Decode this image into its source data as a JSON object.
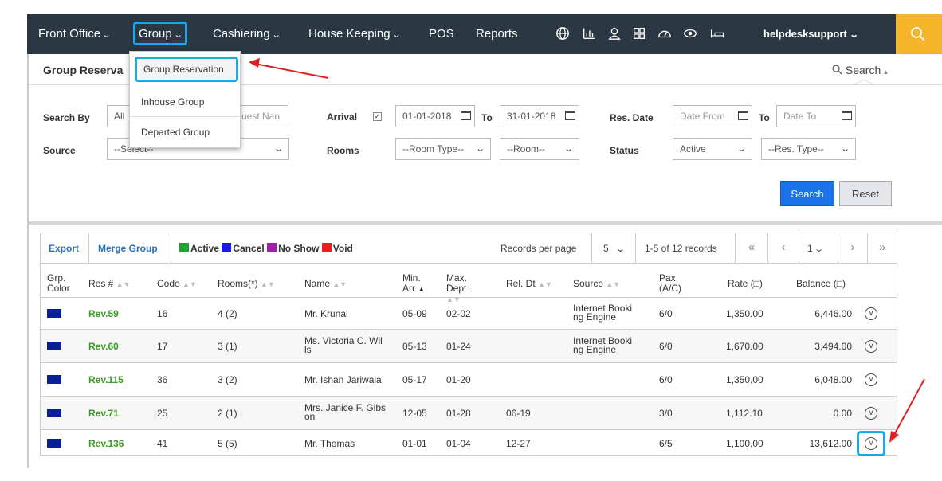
{
  "nav": {
    "front_office": "Front Office",
    "group": "Group",
    "cashiering": "Cashiering",
    "house_keeping": "House Keeping",
    "pos": "POS",
    "reports": "Reports",
    "user": "helpdesksupport",
    "icons": [
      "globe-icon",
      "chart-icon",
      "user-icon",
      "grid-icon",
      "dashboard-icon",
      "eye-icon",
      "bed-icon"
    ],
    "search_icon": "search-icon",
    "accent": "#1ea7e6",
    "search_bg": "#f5b52a"
  },
  "panel": {
    "title": "Group Reserva",
    "search_toggle": "Search"
  },
  "dropdown": {
    "items": [
      "Group Reservation",
      "Inhouse Group",
      "Departed Group"
    ]
  },
  "form": {
    "search_by_label": "Search By",
    "search_by_value": "All",
    "guest_name_placeholder": "uest Nan",
    "arrival_label": "Arrival",
    "arrival_from": "01-01-2018",
    "to_label": "To",
    "arrival_to": "31-01-2018",
    "res_date_label": "Res. Date",
    "date_from_placeholder": "Date From",
    "date_to_placeholder": "Date To",
    "source_label": "Source",
    "source_value": "--Select--",
    "rooms_label": "Rooms",
    "room_type_value": "--Room Type--",
    "room_value": "--Room--",
    "status_label": "Status",
    "status_value": "Active",
    "res_type_value": "--Res. Type--",
    "search_button": "Search",
    "reset_button": "Reset"
  },
  "toolbar": {
    "export": "Export",
    "merge_group": "Merge Group",
    "legend": [
      {
        "label": "Active",
        "color": "#1fa533"
      },
      {
        "label": "Cancel",
        "color": "#1a1ae6"
      },
      {
        "label": "No Show",
        "color": "#a020a8"
      },
      {
        "label": "Void",
        "color": "#e62020"
      }
    ],
    "records_per_page_label": "Records per page",
    "records_per_page": "5",
    "records_info": "1-5 of 12 records",
    "page": "1"
  },
  "table": {
    "headers": {
      "grp_color": "Grp. Color",
      "res": "Res #",
      "code": "Code",
      "rooms": "Rooms(*)",
      "name": "Name",
      "min_arr": "Min. Arr",
      "max_dept": "Max. Dept",
      "rel_dt": "Rel. Dt",
      "source": "Source",
      "pax": "Pax (A/C)",
      "rate": "Rate (□)",
      "balance": "Balance (□)"
    },
    "rows": [
      {
        "res": "Rev.59",
        "code": "16",
        "rooms": "4 (2)",
        "name": "Mr. Krunal",
        "arr": "05-09",
        "dept": "02-02",
        "rel": "",
        "source": "Internet Booki\nng Engine",
        "pax": "6/0",
        "rate": "1,350.00",
        "balance": "6,446.00"
      },
      {
        "res": "Rev.60",
        "code": "17",
        "rooms": "3 (1)",
        "name": "Ms. Victoria C. Wil\nls",
        "arr": "05-13",
        "dept": "01-24",
        "rel": "",
        "source": "Internet Booki\nng Engine",
        "pax": "6/0",
        "rate": "1,670.00",
        "balance": "3,494.00"
      },
      {
        "res": "Rev.115",
        "code": "36",
        "rooms": "3 (2)",
        "name": "Mr. Ishan Jariwala",
        "arr": "05-17",
        "dept": "01-20",
        "rel": "",
        "source": "",
        "pax": "6/0",
        "rate": "1,350.00",
        "balance": "6,048.00"
      },
      {
        "res": "Rev.71",
        "code": "25",
        "rooms": "2 (1)",
        "name": "Mrs. Janice F. Gibs\non",
        "arr": "12-05",
        "dept": "01-28",
        "rel": "06-19",
        "source": "",
        "pax": "3/0",
        "rate": "1,112.10",
        "balance": "0.00"
      },
      {
        "res": "Rev.136",
        "code": "41",
        "rooms": "5 (5)",
        "name": "Mr. Thomas",
        "arr": "01-01",
        "dept": "01-04",
        "rel": "12-27",
        "source": "",
        "pax": "6/5",
        "rate": "1,100.00",
        "balance": "13,612.00"
      }
    ],
    "group_color": "#0a1f96"
  }
}
